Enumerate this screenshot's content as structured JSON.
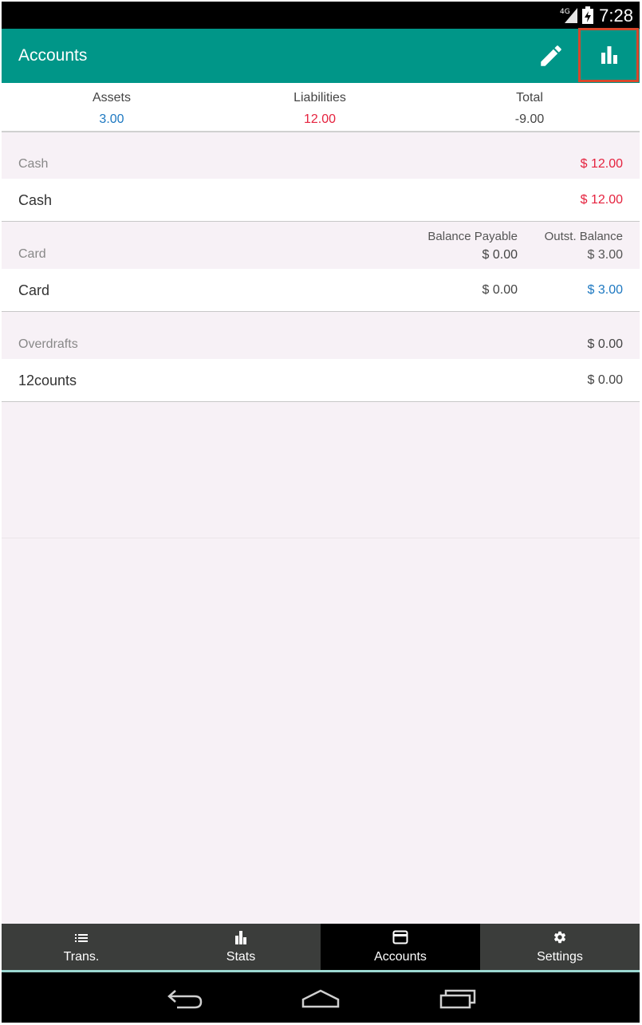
{
  "status_bar": {
    "network": "4G",
    "time": "7:28"
  },
  "app_bar": {
    "title": "Accounts",
    "edit_icon": "pencil-icon",
    "stats_icon": "bar-chart-icon"
  },
  "summary": {
    "assets_label": "Assets",
    "assets_value": "3.00",
    "liabilities_label": "Liabilities",
    "liabilities_value": "12.00",
    "total_label": "Total",
    "total_value": "-9.00"
  },
  "groups": {
    "cash": {
      "name": "Cash",
      "amount": "$ 12.00",
      "row_name": "Cash",
      "row_amount": "$ 12.00"
    },
    "card": {
      "name": "Card",
      "col1_header": "Balance Payable",
      "col1_value": "$ 0.00",
      "col2_header": "Outst. Balance",
      "col2_value": "$ 3.00",
      "row_name": "Card",
      "row_col1": "$ 0.00",
      "row_col2": "$ 3.00"
    },
    "overdrafts": {
      "name": "Overdrafts",
      "amount": "$ 0.00",
      "row_name": "12counts",
      "row_amount": "$ 0.00"
    }
  },
  "tabs": [
    {
      "label": "Trans.",
      "icon": "list-icon"
    },
    {
      "label": "Stats",
      "icon": "bar-chart-icon"
    },
    {
      "label": "Accounts",
      "icon": "card-icon",
      "active": true
    },
    {
      "label": "Settings",
      "icon": "gear-icon"
    }
  ],
  "colors": {
    "accent": "#009688",
    "positive": "#1d78c1",
    "negative": "#e5223e",
    "highlight": "#d9472b"
  }
}
